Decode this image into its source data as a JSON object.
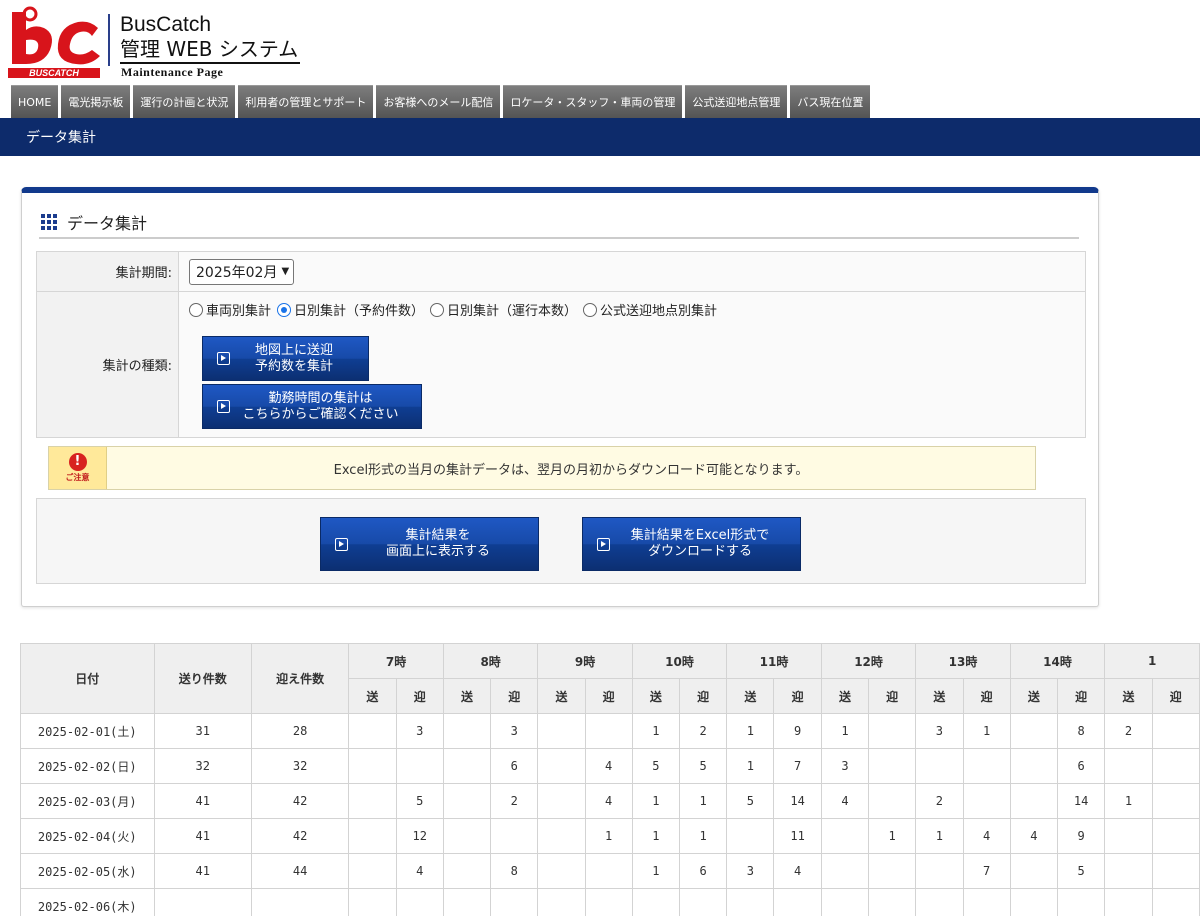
{
  "brand": {
    "logo_text": "BUSCATCH",
    "title": "BusCatch",
    "subtitle": "管理 WEB システム",
    "tagline": "Maintenance Page",
    "colors": {
      "logo_red": "#d8141b",
      "nav_blue": "#0d2b6b"
    }
  },
  "nav": {
    "items": [
      {
        "label": "HOME"
      },
      {
        "label": "電光掲示板"
      },
      {
        "label": "運行の計画と状況"
      },
      {
        "label": "利用者の管理とサポート"
      },
      {
        "label": "お客様へのメール配信"
      },
      {
        "label": "ロケータ・スタッフ・車両の管理"
      },
      {
        "label": "公式送迎地点管理"
      },
      {
        "label": "バス現在位置"
      }
    ]
  },
  "subbar": {
    "title": "データ集計"
  },
  "panel": {
    "title": "データ集計",
    "period_label": "集計期間:",
    "period_value": "2025年02月",
    "type_label": "集計の種類:",
    "radios": [
      {
        "label": "車両別集計",
        "checked": false
      },
      {
        "label": "日別集計（予約件数）",
        "checked": true
      },
      {
        "label": "日別集計（運行本数）",
        "checked": false
      },
      {
        "label": "公式送迎地点別集計",
        "checked": false
      }
    ],
    "map_button": {
      "line1": "地図上に送迎",
      "line2": "予約数を集計"
    },
    "worktime_button": {
      "line1": "勤務時間の集計は",
      "line2": "こちらからご確認ください"
    },
    "notice": {
      "badge": "ご注意",
      "text": "Excel形式の当月の集計データは、翌月の月初からダウンロード可能となります。"
    },
    "show_button": {
      "line1": "集計結果を",
      "line2": "画面上に表示する"
    },
    "excel_button": {
      "line1": "集計結果をExcel形式で",
      "line2": "ダウンロードする"
    }
  },
  "results": {
    "headers": {
      "date": "日付",
      "send_total": "送り件数",
      "pick_total": "迎え件数",
      "send": "送",
      "pick": "迎"
    },
    "hours": [
      "7時",
      "8時",
      "9時",
      "10時",
      "11時",
      "12時",
      "13時",
      "14時",
      "1"
    ],
    "rows": [
      {
        "date": "2025-02-01(土)",
        "send": "31",
        "pick": "28",
        "cells": [
          "",
          "3",
          "",
          "3",
          "",
          "",
          "1",
          "2",
          "1",
          "9",
          "1",
          "",
          "3",
          "1",
          "",
          "8",
          "2"
        ]
      },
      {
        "date": "2025-02-02(日)",
        "send": "32",
        "pick": "32",
        "cells": [
          "",
          "",
          "",
          "6",
          "",
          "4",
          "5",
          "5",
          "1",
          "7",
          "3",
          "",
          "",
          "",
          "",
          "6",
          ""
        ]
      },
      {
        "date": "2025-02-03(月)",
        "send": "41",
        "pick": "42",
        "cells": [
          "",
          "5",
          "",
          "2",
          "",
          "4",
          "1",
          "1",
          "5",
          "14",
          "4",
          "",
          "2",
          "",
          "",
          "14",
          "1"
        ]
      },
      {
        "date": "2025-02-04(火)",
        "send": "41",
        "pick": "42",
        "cells": [
          "",
          "12",
          "",
          "",
          "",
          "1",
          "1",
          "1",
          "",
          "11",
          "",
          "1",
          "1",
          "4",
          "4",
          "9",
          ""
        ]
      },
      {
        "date": "2025-02-05(水)",
        "send": "41",
        "pick": "44",
        "cells": [
          "",
          "4",
          "",
          "8",
          "",
          "",
          "1",
          "6",
          "3",
          "4",
          "",
          "",
          "",
          "7",
          "",
          "5",
          ""
        ]
      },
      {
        "date": "2025-02-06(木)",
        "send": "",
        "pick": "",
        "cells": [
          "",
          "",
          "",
          "",
          "",
          "",
          "",
          "",
          "",
          "",
          "",
          "",
          "",
          "",
          "",
          "",
          ""
        ]
      }
    ]
  }
}
